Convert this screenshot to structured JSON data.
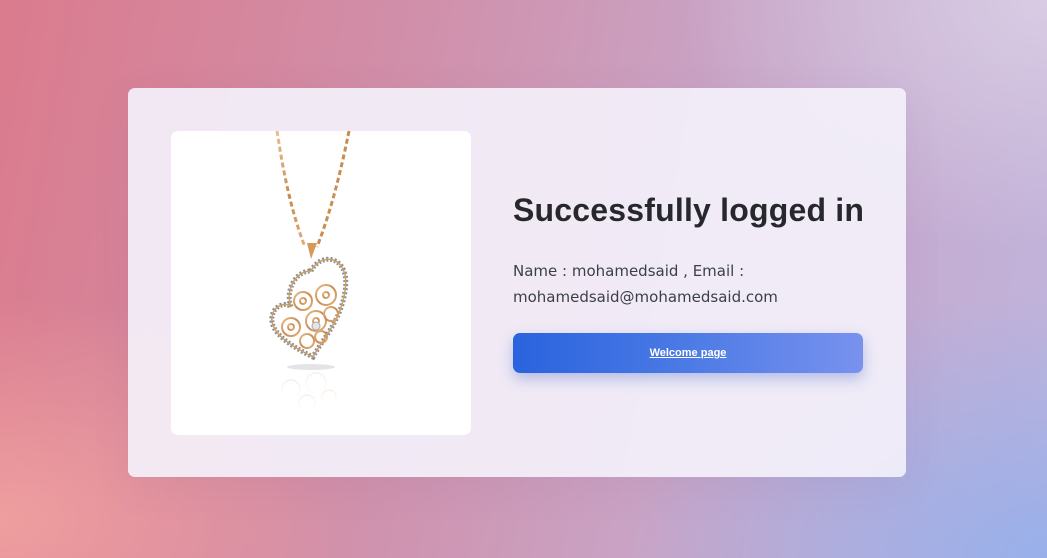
{
  "card": {
    "image_alt": "Heart pendant necklace",
    "title": "Successfully logged in",
    "name_label": "Name : mohamedsaid , Email :",
    "email_value": "mohamedsaid@mohamedsaid.com",
    "welcome_button_label": "Welcome page"
  },
  "colors": {
    "title": "#26282c",
    "button_start": "#2a63de",
    "button_end": "#7992ee"
  }
}
